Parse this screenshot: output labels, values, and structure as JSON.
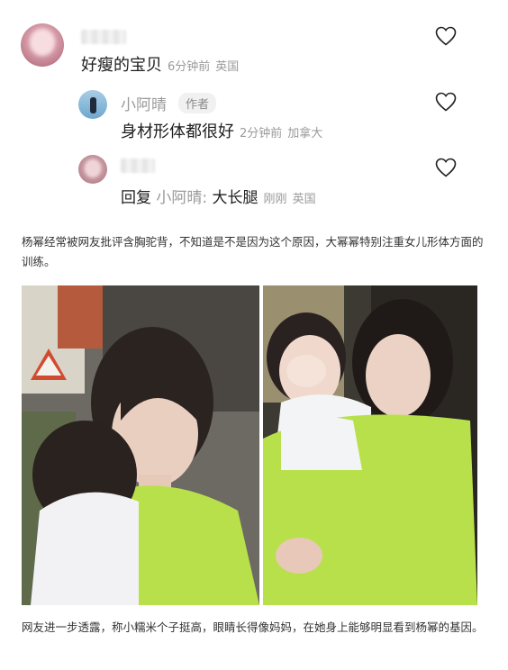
{
  "comments": [
    {
      "text": "好瘦的宝贝",
      "time": "6分钟前",
      "location": "英国"
    },
    {
      "name": "小阿晴",
      "badge": "作者",
      "text": "身材形体都很好",
      "time": "2分钟前",
      "location": "加拿大"
    },
    {
      "reply_label": "回复",
      "reply_to": "小阿晴:",
      "text": "大长腿",
      "time": "刚刚",
      "location": "英国"
    }
  ],
  "article": {
    "paragraph1": "杨幂经常被网友批评含胸驼背，不知道是不是因为这个原因，大幂幂特别注重女儿形体方面的训练。",
    "paragraph2": "网友进一步透露，称小糯米个子挺高，眼睛长得像妈妈，在她身上能够明显看到杨幂的基因。"
  },
  "colors": {
    "green_shirt": "#b8e04a",
    "meta_gray": "#9a9a9a"
  },
  "icons": [
    "heart-outline-icon"
  ]
}
